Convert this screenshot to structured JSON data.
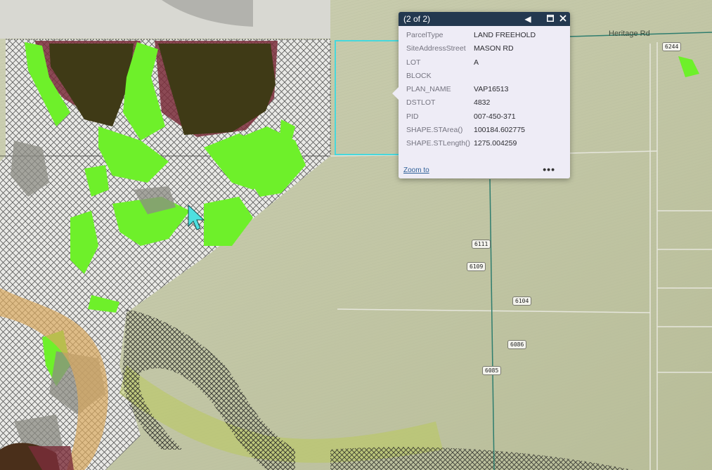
{
  "map": {
    "road_labels": [
      "Heritage Rd"
    ],
    "address_labels": [
      "6244",
      "6111",
      "6109",
      "6104",
      "6086",
      "6085"
    ],
    "colors": {
      "base_field": "#c3c7a6",
      "vegetation_green": "#6ef02a",
      "dark_forest": "#3f3a16",
      "maroon_zone": "#7a2d3a",
      "hatched_area": "#e6e6e6",
      "orange_corridor": "#d9a85e",
      "selected_parcel_outline": "#46d8dc",
      "parcel_line": "#2e7d6e"
    }
  },
  "popup": {
    "count": "(2 of 2)",
    "prev_icon": "previous-icon",
    "maximize_icon": "maximize-icon",
    "close_icon": "close-icon",
    "attributes": [
      {
        "key": "ParcelType",
        "value": "LAND FREEHOLD"
      },
      {
        "key": "SiteAddressStreet",
        "value": "MASON RD"
      },
      {
        "key": "LOT",
        "value": "A"
      },
      {
        "key": "BLOCK",
        "value": ""
      },
      {
        "key": "PLAN_NAME",
        "value": "VAP16513"
      },
      {
        "key": "DSTLOT",
        "value": "4832"
      },
      {
        "key": "PID",
        "value": "007-450-371"
      },
      {
        "key": "SHAPE.STArea()",
        "value": "100184.602775"
      },
      {
        "key": "SHAPE.STLength()",
        "value": "1275.004259"
      }
    ],
    "zoom_label": "Zoom to",
    "more_label": "•••"
  }
}
